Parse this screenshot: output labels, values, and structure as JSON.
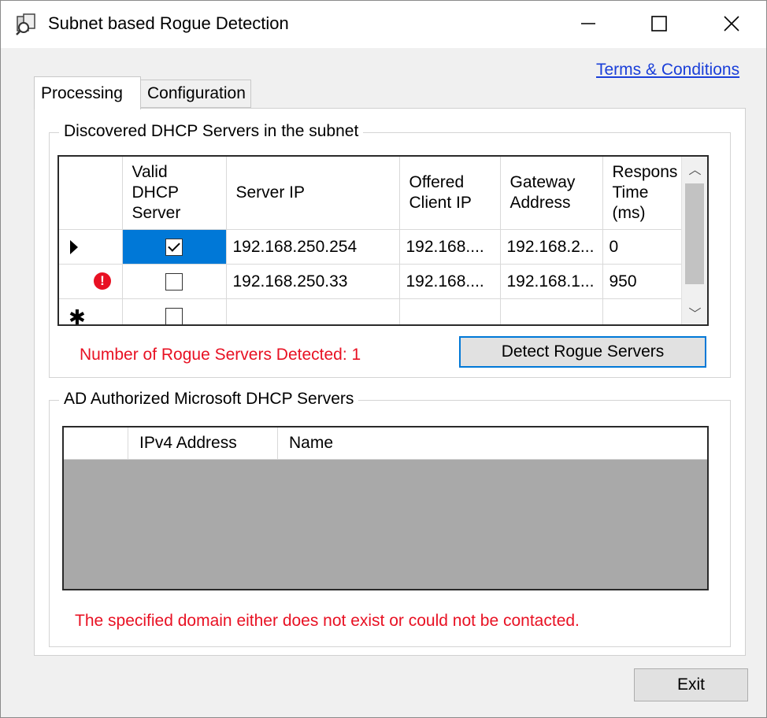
{
  "window": {
    "title": "Subnet based Rogue Detection",
    "controls": [
      "minimize",
      "maximize",
      "close"
    ]
  },
  "terms_link": "Terms & Conditions",
  "tabs": [
    {
      "label": "Processing",
      "selected": true
    },
    {
      "label": "Configuration",
      "selected": false
    }
  ],
  "discovered": {
    "legend": "Discovered DHCP Servers in the subnet",
    "columns": [
      "Valid DHCP Server",
      "Server IP",
      "Offered Client IP",
      "Gateway Address",
      "Respons Time (ms)"
    ],
    "rows": [
      {
        "indicator": "current-row",
        "valid": true,
        "server_ip": "192.168.250.254",
        "offered_client_ip": "192.168....",
        "gateway": "192.168.2...",
        "response_ms": "0"
      },
      {
        "indicator": "error",
        "valid": false,
        "server_ip": "192.168.250.33",
        "offered_client_ip": "192.168....",
        "gateway": "192.168.1...",
        "response_ms": "950"
      },
      {
        "indicator": "new-row",
        "valid": false,
        "server_ip": "",
        "offered_client_ip": "",
        "gateway": "",
        "response_ms": ""
      }
    ],
    "rogue_count_text": "Number of Rogue Servers Detected: 1",
    "detect_button": "Detect Rogue Servers"
  },
  "ad_authorized": {
    "legend": "AD Authorized Microsoft DHCP Servers",
    "columns": [
      "IPv4 Address",
      "Name"
    ],
    "error_text": "The specified domain either does not exist or could not be contacted."
  },
  "exit_button": "Exit",
  "colors": {
    "accent": "#0078d7",
    "error_text": "#e81123",
    "link": "#1a3fd9",
    "empty_grid": "#a9a9a9"
  }
}
